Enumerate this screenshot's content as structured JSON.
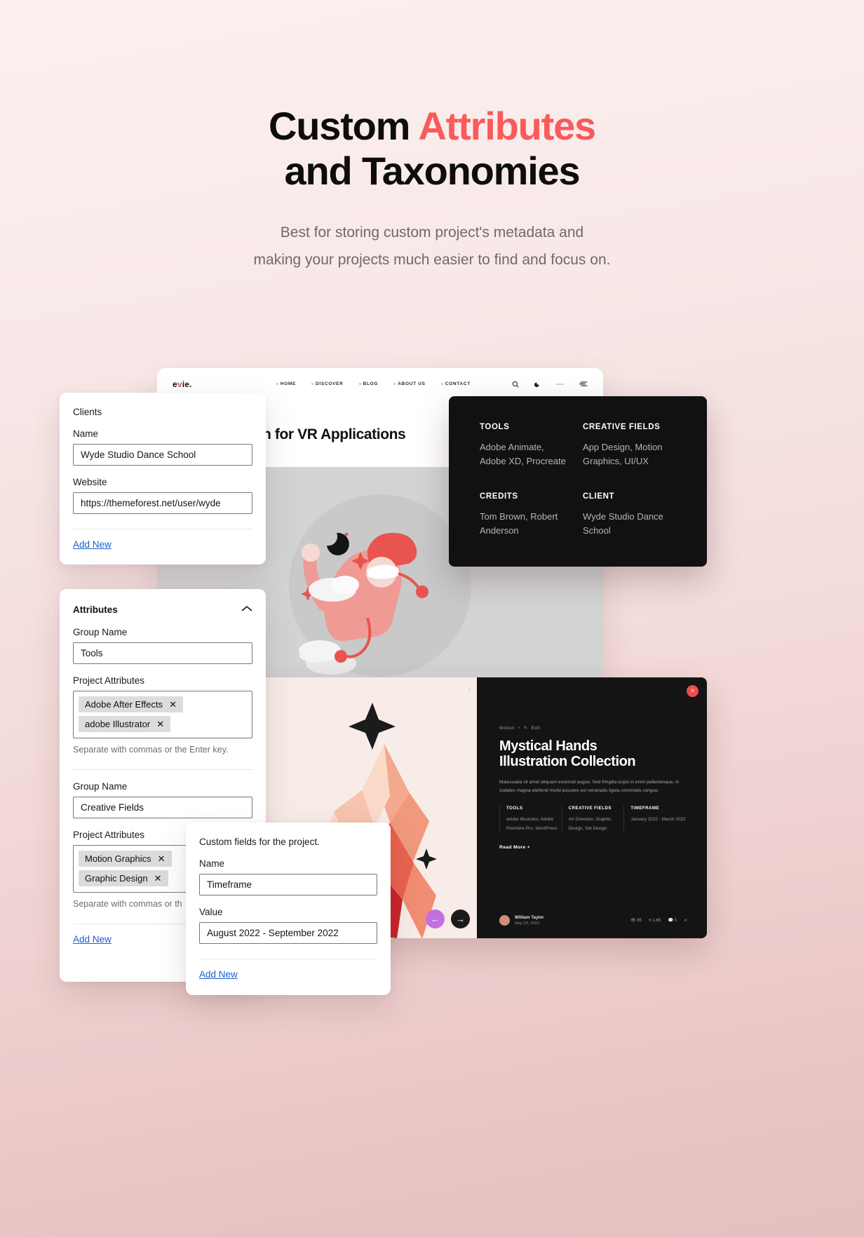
{
  "hero": {
    "title_1": "Custom ",
    "title_accent": "Attributes",
    "title_2": "and Taxonomies",
    "subtitle_line1": "Best for storing custom project's metadata and",
    "subtitle_line2": "making your projects much easier to find and focus on.",
    "accent_color": "#f95a5a"
  },
  "browser": {
    "brand_a": "e",
    "brand_v": "v",
    "brand_b": "ie.",
    "nav": [
      "HOME",
      "DISCOVER",
      "BLOG",
      "ABOUT US",
      "CONTACT"
    ],
    "icons": [
      "search-icon",
      "moon-icon",
      "more-icon",
      "filter-icon"
    ],
    "page_title": "n for VR Applications"
  },
  "dark_panel": {
    "items": [
      {
        "heading": "TOOLS",
        "value": "Adobe Animate,\nAdobe XD, Procreate"
      },
      {
        "heading": "CREATIVE FIELDS",
        "value": "App Design, Motion\nGraphics, UI/UX"
      },
      {
        "heading": "CREDITS",
        "value": "Tom Brown, Robert\nAnderson"
      },
      {
        "heading": "CLIENT",
        "value": "Wyde Studio Dance\nSchool"
      }
    ]
  },
  "clients_card": {
    "title": "Clients",
    "name_label": "Name",
    "name_value": "Wyde Studio Dance School",
    "website_label": "Website",
    "website_value": "https://themeforest.net/user/wyde",
    "add_new": "Add New"
  },
  "attributes_card": {
    "title": "Attributes",
    "collapse_icon": "chevron-up-icon",
    "groups": [
      {
        "group_label": "Group Name",
        "group_value": "Tools",
        "attrs_label": "Project Attributes",
        "chips": [
          "Adobe After Effects",
          "adobe Illustrator"
        ],
        "hint": "Separate with commas or the Enter key."
      },
      {
        "group_label": "Group Name",
        "group_value": "Creative Fields",
        "attrs_label": "Project Attributes",
        "chips": [
          "Motion Graphics",
          "Graphic Design"
        ],
        "hint": "Separate with commas or th"
      }
    ],
    "add_new": "Add New"
  },
  "custom_fields_card": {
    "title": "Custom fields for the project.",
    "name_label": "Name",
    "name_value": "Timeframe",
    "value_label": "Value",
    "value_value": "August 2022 - September 2022",
    "add_new": "Add New"
  },
  "portfolio": {
    "close_icon": "close-icon",
    "page_indicator": "↑",
    "breadcrumb_category": "Motion",
    "breadcrumb_edit": "Edit",
    "title_line1": "Mystical Hands",
    "title_line2": "Illustration Collection",
    "description": "Malesuada sit amet aliquam euismod augue. Sed fringilla turpis in enim pellentesque, in sodales magna eleifend morbi posuere est venenatis ligula commodo congue.",
    "meta": [
      {
        "heading": "TOOLS",
        "value": "adobe Illustrator, Adobe Premiere Pro, WordPress"
      },
      {
        "heading": "CREATIVE FIELDS",
        "value": "Art Direction, Graphic Design, Set Design"
      },
      {
        "heading": "TIMEFRAME",
        "value": "January 2022 - March 2022"
      }
    ],
    "read_more": "Read More",
    "author_name": "William Taylor",
    "author_date": "May 23, 2022",
    "stats": [
      "85",
      "1.6K",
      "0"
    ],
    "prev_icon": "arrow-left-icon",
    "next_icon": "arrow-right-icon"
  }
}
